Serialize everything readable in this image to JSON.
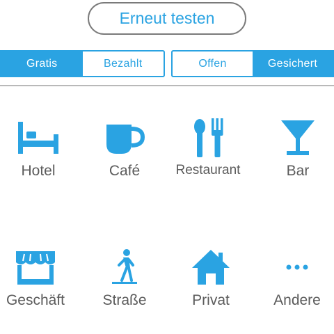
{
  "retry": {
    "label": "Erneut testen"
  },
  "price_filter": {
    "options": [
      {
        "label": "Gratis",
        "selected": true
      },
      {
        "label": "Bezahlt",
        "selected": false
      }
    ]
  },
  "security_filter": {
    "options": [
      {
        "label": "Offen",
        "selected": false
      },
      {
        "label": "Gesichert",
        "selected": true
      }
    ]
  },
  "categories": [
    {
      "label": "Hotel",
      "icon": "bed-icon"
    },
    {
      "label": "Café",
      "icon": "cup-icon"
    },
    {
      "label": "Restaurant",
      "icon": "fork-spoon-icon"
    },
    {
      "label": "Bar",
      "icon": "cocktail-glass-icon"
    },
    {
      "label": "Geschäft",
      "icon": "store-icon"
    },
    {
      "label": "Straße",
      "icon": "walking-person-icon"
    },
    {
      "label": "Privat",
      "icon": "house-icon"
    },
    {
      "label": "Andere",
      "icon": "more-dots-icon"
    }
  ],
  "colors": {
    "accent": "#2aa3e2",
    "label_text": "#5b5b5b",
    "border_gray": "#7a7a7a"
  }
}
